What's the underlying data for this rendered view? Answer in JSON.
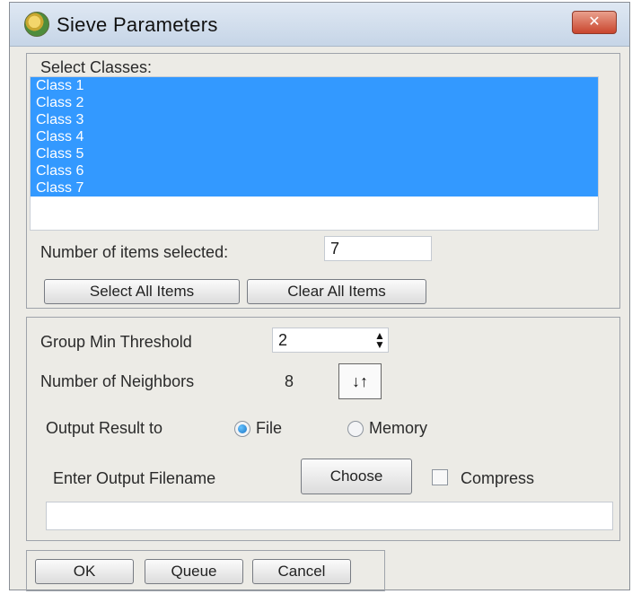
{
  "window": {
    "title": "Sieve Parameters",
    "close_label": "✕"
  },
  "classes": {
    "label": "Select Classes:",
    "items": [
      "Class 1",
      "Class 2",
      "Class 3",
      "Class 4",
      "Class 5",
      "Class 6",
      "Class 7"
    ],
    "count_label": "Number of items selected:",
    "count_value": "7",
    "select_all_label": "Select All Items",
    "clear_all_label": "Clear All Items"
  },
  "parameters": {
    "threshold_label": "Group Min Threshold",
    "threshold_value": "2",
    "neighbors_label": "Number of Neighbors",
    "neighbors_value": "8",
    "neighbors_toggle_icon": "swap-arrows-icon",
    "output_label": "Output Result to",
    "output_options": [
      "File",
      "Memory"
    ],
    "output_selected": "File",
    "filename_label": "Enter Output Filename",
    "choose_label": "Choose",
    "compress_label": "Compress",
    "filename_value": ""
  },
  "buttons": {
    "ok": "OK",
    "queue": "Queue",
    "cancel": "Cancel"
  },
  "colors": {
    "selection": "#3399ff",
    "titlebar": "#c6d5e7",
    "close": "#c9452d"
  }
}
